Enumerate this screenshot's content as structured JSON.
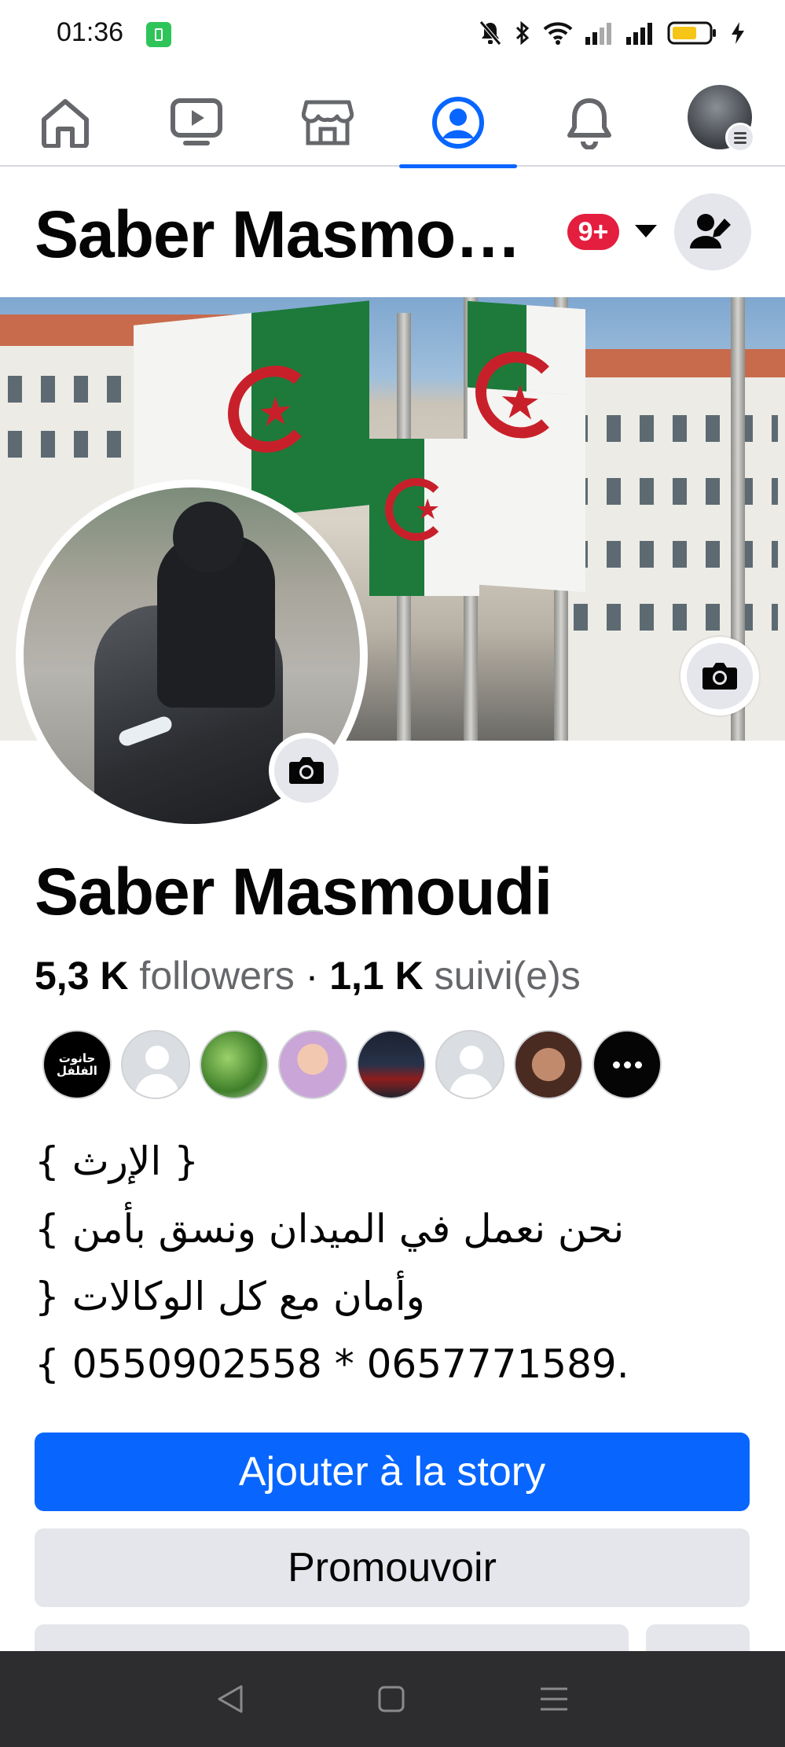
{
  "status_bar": {
    "time": "01:36",
    "icons": [
      "battery-saver-icon",
      "mute-icon",
      "bluetooth-icon",
      "wifi-icon",
      "signal-icon",
      "signal-icon",
      "battery-icon",
      "charging-icon"
    ],
    "battery_level": 0.6,
    "accent": "#2fc45a"
  },
  "top_nav": {
    "items": [
      "home-icon",
      "video-icon",
      "marketplace-icon",
      "profile-icon",
      "notifications-icon",
      "menu-avatar"
    ],
    "active": "profile-icon",
    "active_color": "#0866ff"
  },
  "header": {
    "name": "Saber Masmo…",
    "badge": "9+",
    "badge_color": "#e41e3f"
  },
  "profile": {
    "name": "Saber Masmoudi",
    "followers_count": "5,3 K",
    "followers_label": "followers",
    "separator": "·",
    "following_count": "1,1 K",
    "following_label": "suivi(e)s"
  },
  "followers_avatars": [
    "حانوت الفلفل",
    "placeholder",
    "plants",
    "woman",
    "night-street",
    "placeholder",
    "face",
    "more"
  ],
  "bio": {
    "lines": [
      "{ الإرث }",
      "نحن نعمل في الميدان ونسق بأمن }",
      "وأمان مع كل الوكالات {",
      "{ 0550902558 * 0657771589."
    ]
  },
  "buttons": {
    "add_story": "Ajouter à la story",
    "promote": "Promouvoir"
  },
  "colors": {
    "primary": "#0866ff",
    "secondary_bg": "#e4e6eb",
    "muted_text": "#65676b"
  }
}
